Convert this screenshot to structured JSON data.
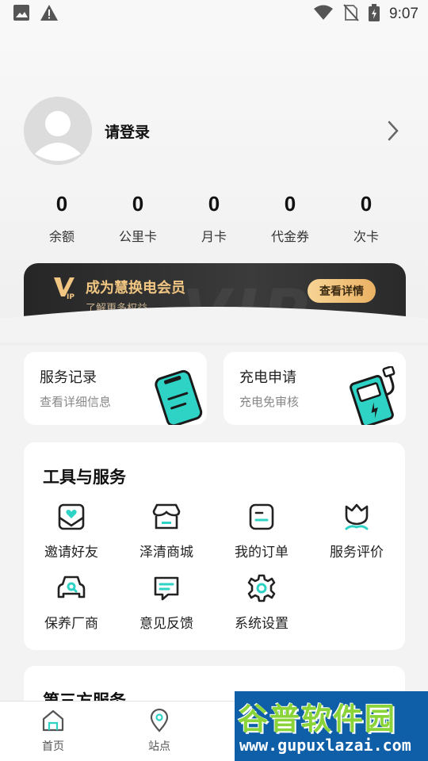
{
  "status_bar": {
    "time": "9:07",
    "icons": [
      "image-icon",
      "warning-icon",
      "wifi-icon",
      "no-sim-icon",
      "battery-charging-icon"
    ]
  },
  "profile": {
    "login_text": "请登录",
    "avatar_icon": "user-avatar-icon",
    "chevron_icon": "chevron-right-icon"
  },
  "stats": [
    {
      "value": "0",
      "label": "余额"
    },
    {
      "value": "0",
      "label": "公里卡"
    },
    {
      "value": "0",
      "label": "月卡"
    },
    {
      "value": "0",
      "label": "代金券"
    },
    {
      "value": "0",
      "label": "次卡"
    }
  ],
  "vip_banner": {
    "logo_text": "VIP",
    "title": "成为慧换电会员",
    "subtitle": "了解更多权益",
    "button_label": "查看详情",
    "background_mark": "VIP"
  },
  "cards": [
    {
      "title": "服务记录",
      "subtitle": "查看详细信息",
      "icon": "phone-record-icon"
    },
    {
      "title": "充电申请",
      "subtitle": "充电免审核",
      "icon": "charger-icon"
    }
  ],
  "tools": {
    "title": "工具与服务",
    "items": [
      {
        "label": "邀请好友",
        "icon": "invite-heart-icon"
      },
      {
        "label": "泽清商城",
        "icon": "store-icon"
      },
      {
        "label": "我的订单",
        "icon": "order-icon"
      },
      {
        "label": "服务评价",
        "icon": "flower-rating-icon"
      },
      {
        "label": "保养厂商",
        "icon": "car-maintenance-icon"
      },
      {
        "label": "意见反馈",
        "icon": "feedback-message-icon"
      },
      {
        "label": "系统设置",
        "icon": "settings-gear-icon"
      }
    ]
  },
  "third_party": {
    "title": "第三方服务"
  },
  "tabbar": {
    "tabs": [
      {
        "label": "首页",
        "icon": "home-icon"
      },
      {
        "label": "站点",
        "icon": "location-pin-icon"
      }
    ]
  },
  "watermark": {
    "line1": "谷普软件园",
    "line2": "www.gupuxlazai.com"
  },
  "colors": {
    "accent_teal": "#2fd3c5",
    "vip_gold": "#f1c582",
    "vip_button": "#eab163",
    "dark": "#262626"
  }
}
